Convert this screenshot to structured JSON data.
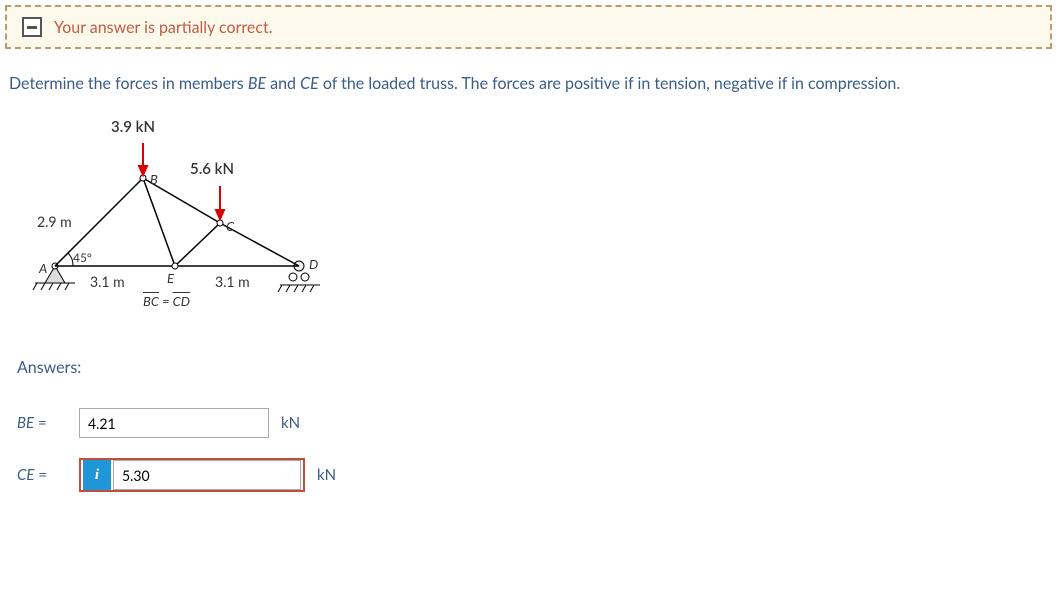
{
  "feedback": {
    "message": "Your answer is partially correct."
  },
  "question": {
    "prefix": "Determine the forces in members ",
    "member1": "BE",
    "mid1": " and ",
    "member2": "CE",
    "suffix": " of the loaded truss. The forces are positive if in tension, negative if in compression."
  },
  "diagram": {
    "load_top": "3.9 kN",
    "load_mid": "5.6 kN",
    "dim_left": "2.9 m",
    "angle": "45°",
    "node_a": "A",
    "node_b": "B",
    "node_c": "C",
    "node_d": "D",
    "node_e": "E",
    "span_left": "3.1 m",
    "span_right": "3.1 m",
    "bc_label": "BC",
    "cd_label": "CD",
    "equals": " = "
  },
  "answers": {
    "heading": "Answers:",
    "be_label_var": "BE",
    "eq": " =",
    "be_value": "4.21",
    "be_unit": "kN",
    "ce_label_var": "CE",
    "ce_value": "5.30",
    "ce_unit": "kN",
    "info_label": "i"
  }
}
